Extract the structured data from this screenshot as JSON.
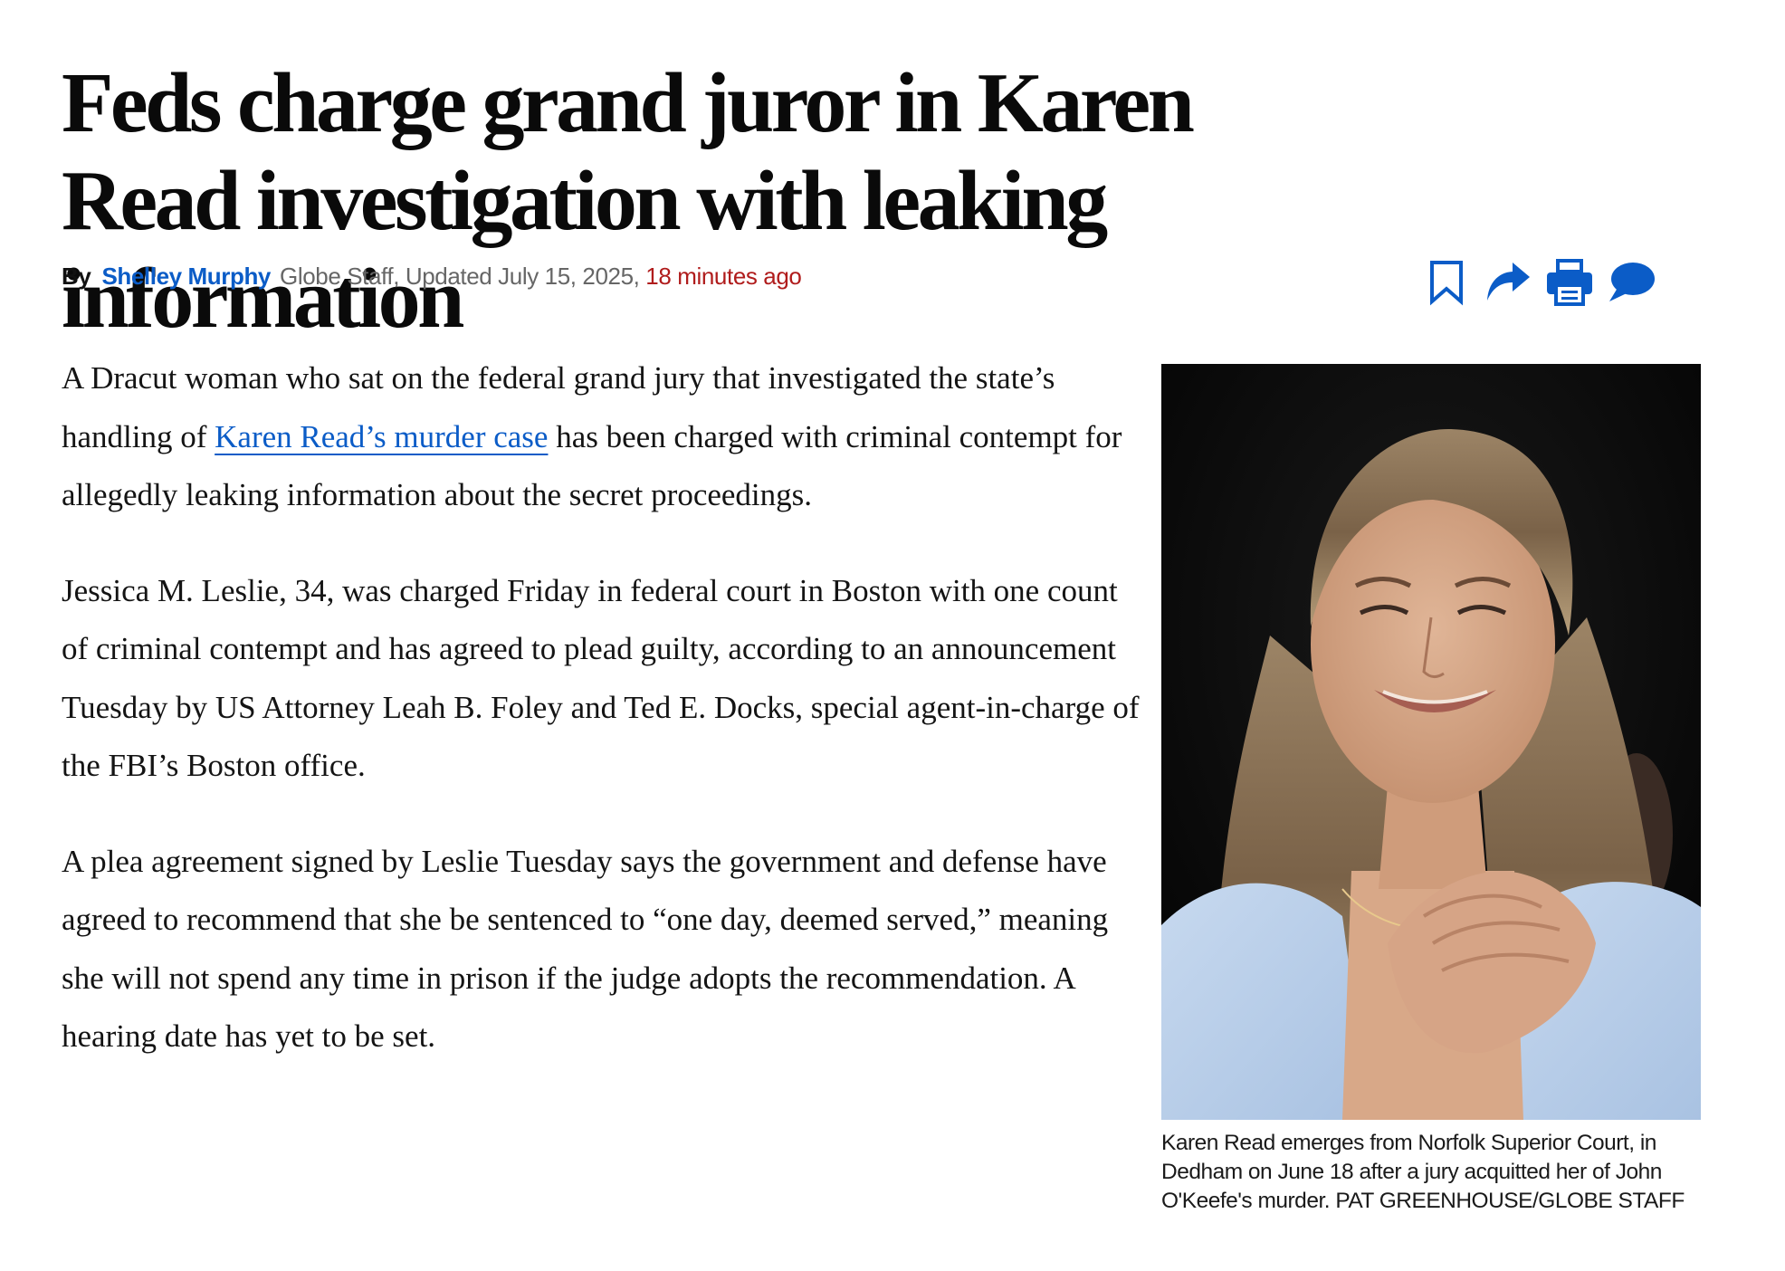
{
  "article": {
    "headline": "Feds charge grand juror in Karen Read investigation with leaking information",
    "byline": {
      "by": "By",
      "author": "Shelley Murphy",
      "meta": "Globe Staff, Updated July 15, 2025,",
      "ago": "18 minutes ago"
    },
    "tools": {
      "icons": [
        "bookmark-icon",
        "share-icon",
        "print-icon",
        "comment-icon"
      ],
      "color": "#0b5cc7"
    },
    "paragraphs": [
      {
        "before": "A Dracut woman who sat on the federal grand jury that investigated the state’s handling of ",
        "link": "Karen Read’s murder case",
        "after": " has been charged with criminal contempt for allegedly leaking information about the secret proceedings."
      },
      {
        "text": "Jessica M. Leslie, 34, was charged Friday in federal court in Boston with one count of criminal contempt and has agreed to plead guilty, according to an announcement Tuesday by US Attorney Leah B. Foley and Ted E. Docks, special agent-in-charge of the FBI’s Boston office."
      },
      {
        "text": "A plea agreement signed by Leslie Tuesday says the government and defense have agreed to recommend that she be sentenced to “one day, deemed served,” meaning she will not spend any time in prison if the judge adopts the recommendation. A hearing date has yet to be set."
      }
    ],
    "photo": {
      "caption": "Karen Read emerges from Norfolk Superior Court, in Dedham on June 18 after a jury acquitted her of John O'Keefe's murder.  PAT GREENHOUSE/GLOBE STAFF"
    }
  },
  "colors": {
    "link": "#0b5cc7",
    "timestamp": "#b01c1c",
    "meta": "#666666"
  }
}
